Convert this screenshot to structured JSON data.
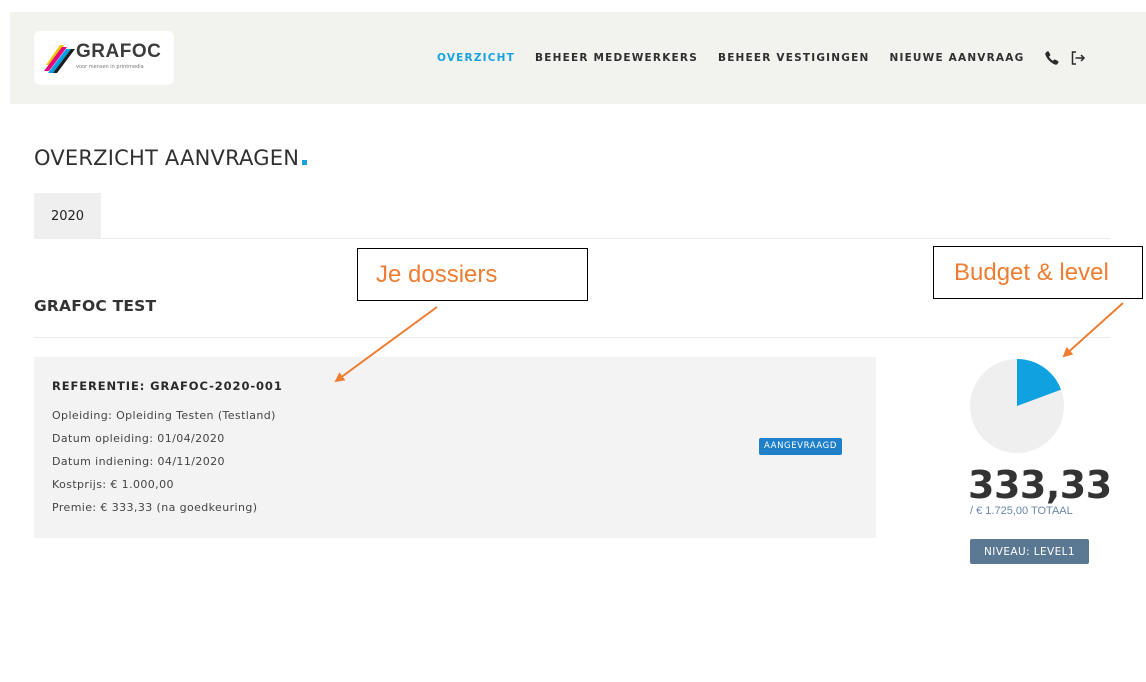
{
  "header": {
    "logo": {
      "brand": "GRAFOC",
      "tagline": "voor mensen in printmedia",
      "colors": [
        "#f5c400",
        "#e5007e",
        "#00a0e3",
        "#1d1d1b"
      ]
    },
    "nav": [
      {
        "label": "OVERZICHT",
        "active": true
      },
      {
        "label": "BEHEER MEDEWERKERS",
        "active": false
      },
      {
        "label": "BEHEER VESTIGINGEN",
        "active": false
      },
      {
        "label": "NIEUWE AANVRAAG",
        "active": false
      }
    ],
    "icons": [
      "phone-icon",
      "logout-icon"
    ],
    "accent_color": "#17a3e0"
  },
  "page": {
    "title": "OVERZICHT AANVRAGEN",
    "year_tab": "2020",
    "organisation": "GRAFOC TEST"
  },
  "dossier": {
    "reference": "REFERENTIE: GRAFOC-2020-001",
    "lines": [
      "Opleiding: Opleiding Testen (Testland)",
      "Datum opleiding: 01/04/2020",
      "Datum indiening: 04/11/2020",
      "Kostprijs: € 1.000,00",
      "Premie: € 333,33 (na goedkeuring)"
    ],
    "status": "AANGEVRAAGD",
    "status_color": "#1f7fc8"
  },
  "budget": {
    "used_fraction": 0.1932,
    "value": "333,33",
    "total": "/ € 1.725,00 TOTAAL",
    "level": "NIVEAU: LEVEL1",
    "used_color": "#10a1e0",
    "remaining_color": "#efefef"
  },
  "annotations": [
    {
      "text": "Je dossiers",
      "color": "#ed7d31"
    },
    {
      "text": "Budget & level",
      "color": "#ed7d31"
    }
  ]
}
